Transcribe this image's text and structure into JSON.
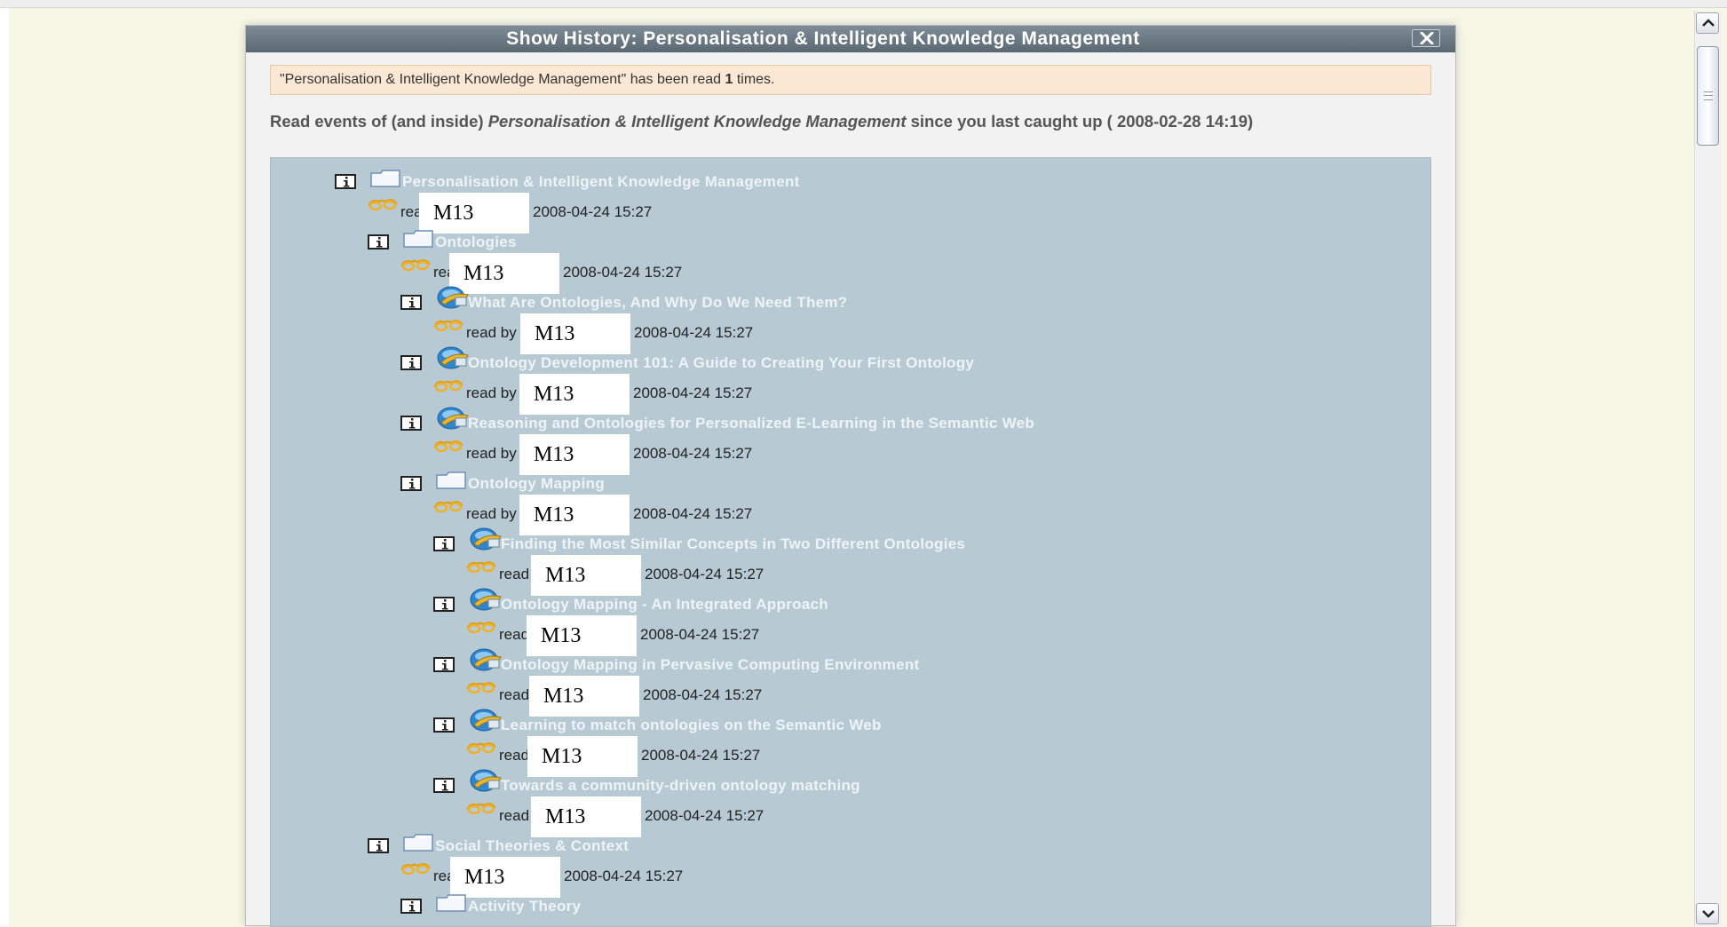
{
  "dialog": {
    "title": "Show History: Personalisation & Intelligent Knowledge Management",
    "notice_prefix": "\"Personalisation & Intelligent Knowledge Management\" has been read ",
    "notice_count": "1",
    "notice_suffix": " times.",
    "caption_prefix": "Read events of (and inside) ",
    "caption_item": "Personalisation & Intelligent Knowledge Management",
    "caption_suffix": " since you last caught up ( 2008-02-28 14:19)"
  },
  "read_label": "read by",
  "tree": [
    {
      "title": "Personalisation & Intelligent Knowledge Management",
      "type": "folder",
      "read_by": "M13",
      "date": "2008-04-24 15:27"
    },
    {
      "title": "Ontologies",
      "type": "folder",
      "read_by": "M13",
      "date": "2008-04-24 15:27"
    },
    {
      "title": "What Are Ontologies, And Why Do We Need Them?",
      "type": "document",
      "read_by": "M13",
      "date": "2008-04-24 15:27"
    },
    {
      "title": "Ontology Development 101: A Guide to Creating Your First Ontology",
      "type": "document",
      "read_by": "M13",
      "date": "2008-04-24 15:27"
    },
    {
      "title": "Reasoning and Ontologies for Personalized E-Learning in the Semantic Web",
      "type": "document",
      "read_by": "M13",
      "date": "2008-04-24 15:27"
    },
    {
      "title": "Ontology Mapping",
      "type": "folder",
      "read_by": "M13",
      "date": "2008-04-24 15:27"
    },
    {
      "title": "Finding the Most Similar Concepts in Two Different Ontologies",
      "type": "document",
      "read_by": "M13",
      "date": "2008-04-24 15:27"
    },
    {
      "title": "Ontology Mapping - An Integrated Approach",
      "type": "document",
      "read_by": "M13",
      "date": "2008-04-24 15:27"
    },
    {
      "title": "Ontology Mapping in Pervasive Computing Environment",
      "type": "document",
      "read_by": "M13",
      "date": "2008-04-24 15:27"
    },
    {
      "title": "Learning to match ontologies on the Semantic Web",
      "type": "document",
      "read_by": "M13",
      "date": "2008-04-24 15:27"
    },
    {
      "title": "Towards a community-driven ontology matching",
      "type": "document",
      "read_by": "M13",
      "date": "2008-04-24 15:27"
    },
    {
      "title": "Social Theories & Context",
      "type": "folder",
      "read_by": "M13",
      "date": "2008-04-24 15:27"
    },
    {
      "title": "Activity Theory",
      "type": "folder"
    }
  ],
  "colors": {
    "page_bg": "#f7f7e6",
    "titlebar": "#66737d",
    "tree_bg": "#b7cad4",
    "notice_bg": "#fbe8d4",
    "item_title": "#eef3f6"
  }
}
